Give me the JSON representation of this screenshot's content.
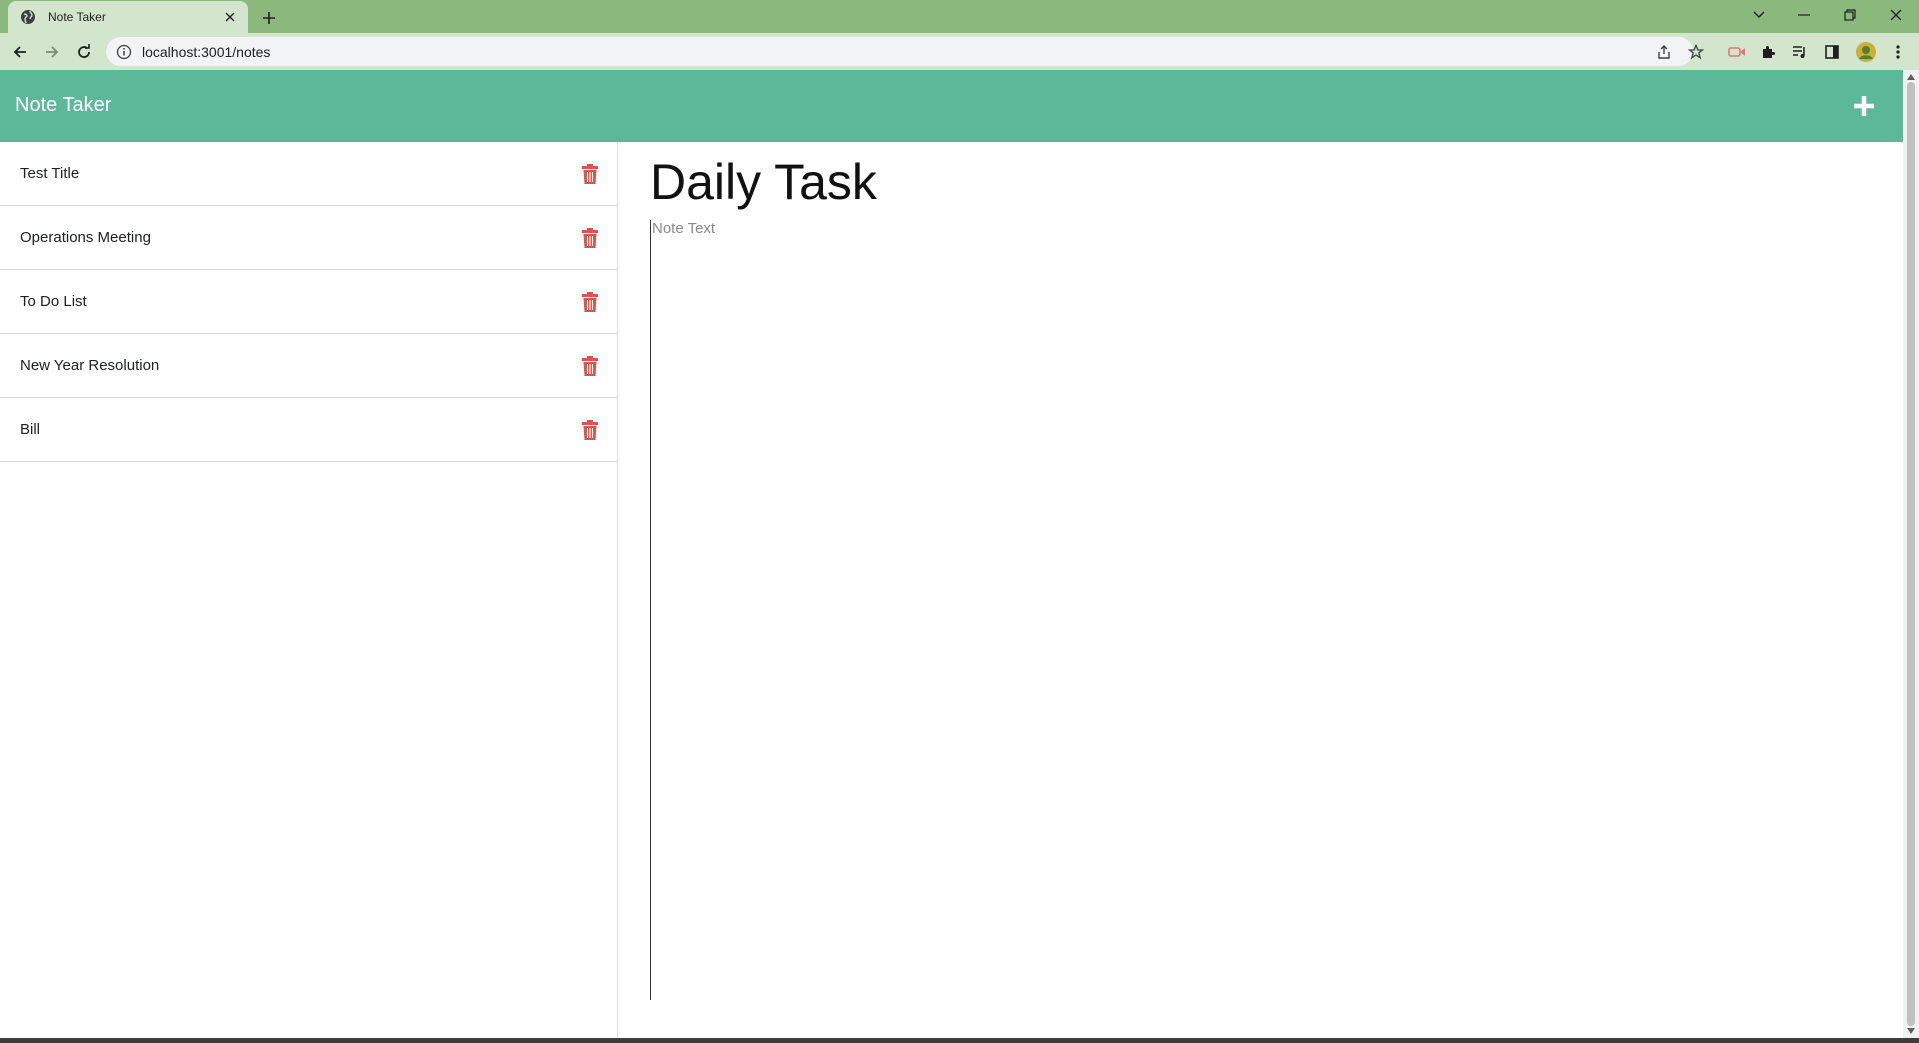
{
  "browser": {
    "tab_title": "Note Taker",
    "url": "localhost:3001/notes"
  },
  "app": {
    "brand": "Note Taker",
    "accent_color": "#5bb99a",
    "delete_color": "#d9534f"
  },
  "notes": [
    {
      "title": "Test Title"
    },
    {
      "title": "Operations Meeting"
    },
    {
      "title": "To Do List"
    },
    {
      "title": "New Year Resolution"
    },
    {
      "title": "Bill"
    }
  ],
  "editor": {
    "title_value": "Daily Task",
    "text_placeholder": "Note Text"
  },
  "icons": {
    "new_note": "plus-icon",
    "delete": "trash-icon"
  }
}
